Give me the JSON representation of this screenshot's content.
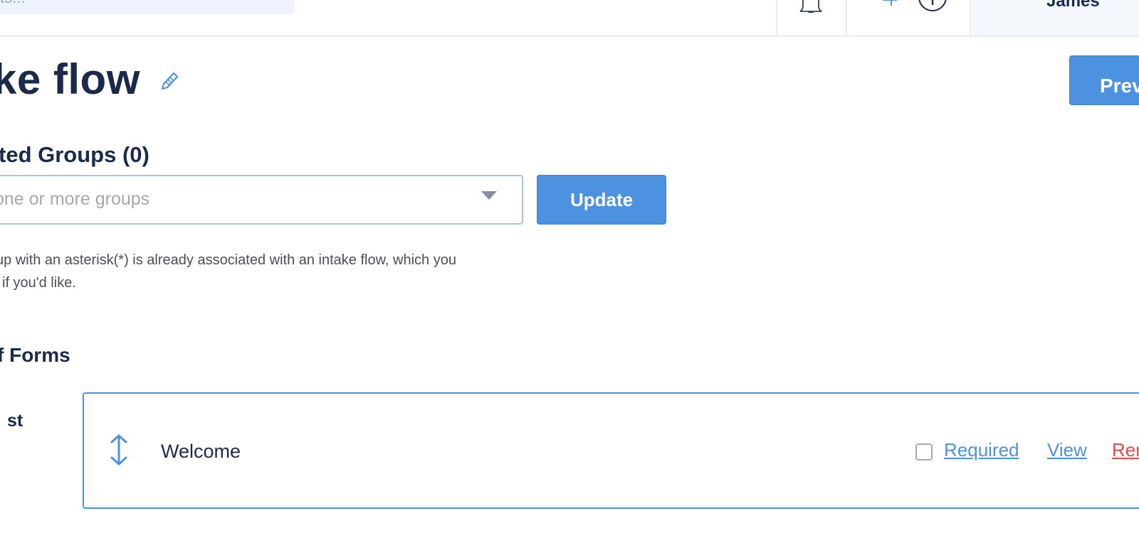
{
  "topbar": {
    "search_placeholder": "ts...",
    "user_name": "James"
  },
  "page": {
    "title": "ke flow",
    "preview_label": "Prev"
  },
  "groups": {
    "heading": "ted Groups (0)",
    "select_placeholder": "one or more groups",
    "update_label": "Update",
    "help_line1": "up with an asterisk(*) is already associated with an intake flow, which you",
    "help_line2": "if you'd like."
  },
  "forms": {
    "heading": "f Forms",
    "step_label": "st",
    "items": [
      {
        "name": "Welcome",
        "required_label": "Required",
        "required_checked": false,
        "view_label": "View",
        "remove_label": "Rem"
      }
    ]
  },
  "colors": {
    "accent": "#4d92e0",
    "text_dark": "#1b2a4a",
    "danger": "#e24b4b",
    "search_bg": "#eef3fd"
  },
  "icons": {
    "search": "search-icon",
    "notifications": "bell-icon",
    "add": "plus-icon",
    "help": "help-icon",
    "edit": "pencil-icon",
    "dropdown": "caret-down-icon",
    "drag": "drag-handle-icon"
  }
}
